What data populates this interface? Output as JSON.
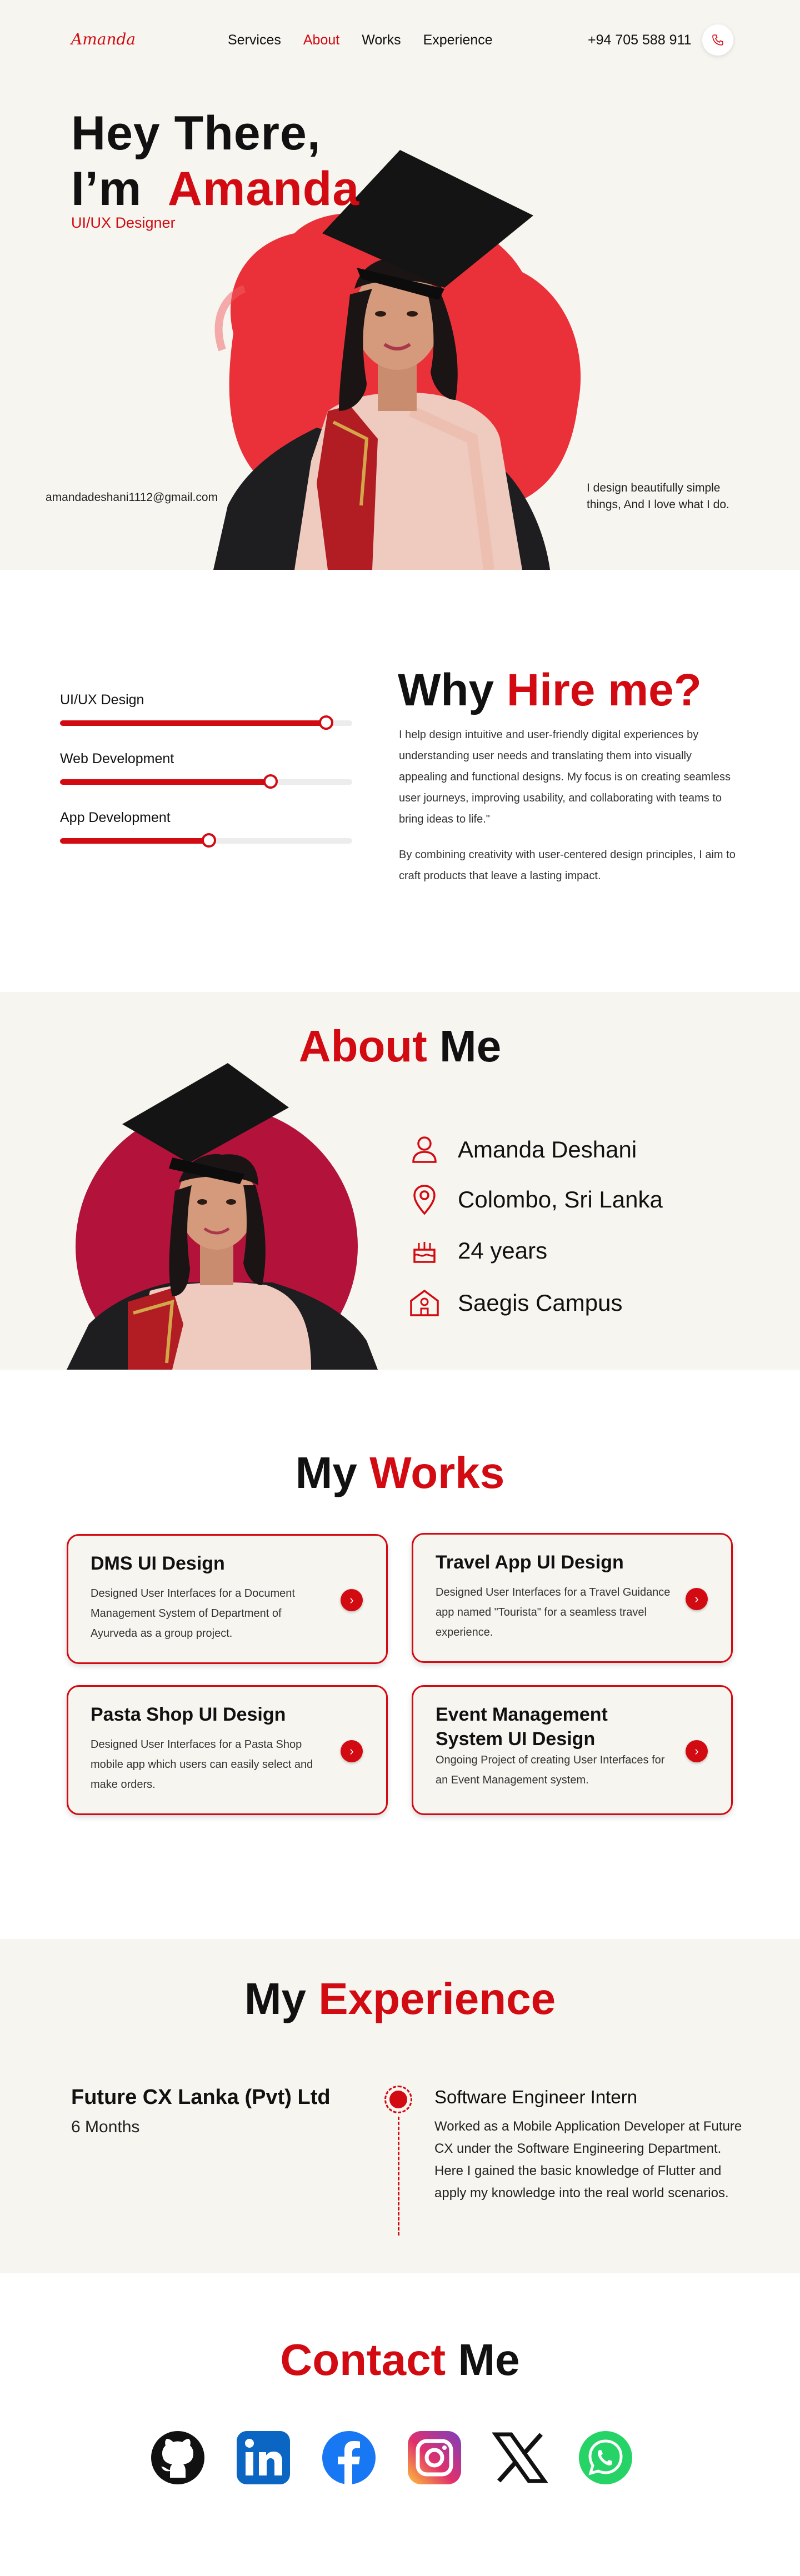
{
  "nav": {
    "logo": "Amanda",
    "links": [
      "Services",
      "About",
      "Works",
      "Experience"
    ],
    "active": "About",
    "phone": "+94 705 588 911"
  },
  "hero": {
    "title_line1": "Hey There,",
    "title_line2_prefix": "I’m",
    "title_name": "Amanda",
    "subtitle": "UI/UX Designer",
    "email": "amandadeshani1112@gmail.com",
    "tagline": "I design beautifully simple things, And I love what I do."
  },
  "hire": {
    "title_black": "Why",
    "title_red": "Hire me?",
    "skills": [
      {
        "label": "UI/UX Design",
        "level": 0.91
      },
      {
        "label": "Web Development",
        "level": 0.72
      },
      {
        "label": "App Development",
        "level": 0.51
      }
    ],
    "paragraph1": "I help design intuitive and user-friendly digital experiences by understanding user needs and translating them into visually appealing and functional designs. My focus is on creating seamless user journeys, improving usability, and collaborating with teams to bring ideas to life.\"",
    "paragraph2": "By combining creativity with user-centered design principles, I aim to craft products that leave a lasting impact."
  },
  "about": {
    "title_red": "About",
    "title_black": "Me",
    "info": [
      {
        "icon": "user-icon",
        "text": "Amanda Deshani"
      },
      {
        "icon": "location-pin-icon",
        "text": "Colombo, Sri Lanka"
      },
      {
        "icon": "cake-icon",
        "text": "24 years"
      },
      {
        "icon": "school-icon",
        "text": "Saegis Campus"
      }
    ]
  },
  "works": {
    "title_black": "My",
    "title_red": "Works",
    "cards": [
      {
        "title": "DMS UI Design",
        "desc": "Designed User Interfaces for a Document Management System of Department of Ayurveda as a group project."
      },
      {
        "title": "Travel App UI Design",
        "desc": "Designed User Interfaces for a Travel Guidance app named \"Tourista\" for a seamless travel experience."
      },
      {
        "title": "Pasta Shop UI Design",
        "desc": "Designed User Interfaces for a Pasta Shop mobile app which users can easily select and make orders."
      },
      {
        "title": "Event Management System UI Design",
        "desc": "Ongoing Project of creating User Interfaces for an Event Management system."
      }
    ]
  },
  "experience": {
    "title_black": "My",
    "title_red": "Experience",
    "company": "Future CX Lanka (Pvt) Ltd",
    "duration": "6 Months",
    "role": "Software Engineer Intern",
    "desc": "Worked as a Mobile Application Developer at Future CX under the Software Engineering Department. Here I gained the basic knowledge of Flutter and apply my knowledge into the real world scenarios."
  },
  "contact": {
    "title_red": "Contact",
    "title_black": "Me",
    "socials": [
      "github-icon",
      "linkedin-icon",
      "facebook-icon",
      "instagram-icon",
      "x-icon",
      "whatsapp-icon"
    ]
  },
  "colors": {
    "accent": "#d20a11",
    "cream": "#f7f5f0",
    "portrait_bg": "#b3133b"
  }
}
